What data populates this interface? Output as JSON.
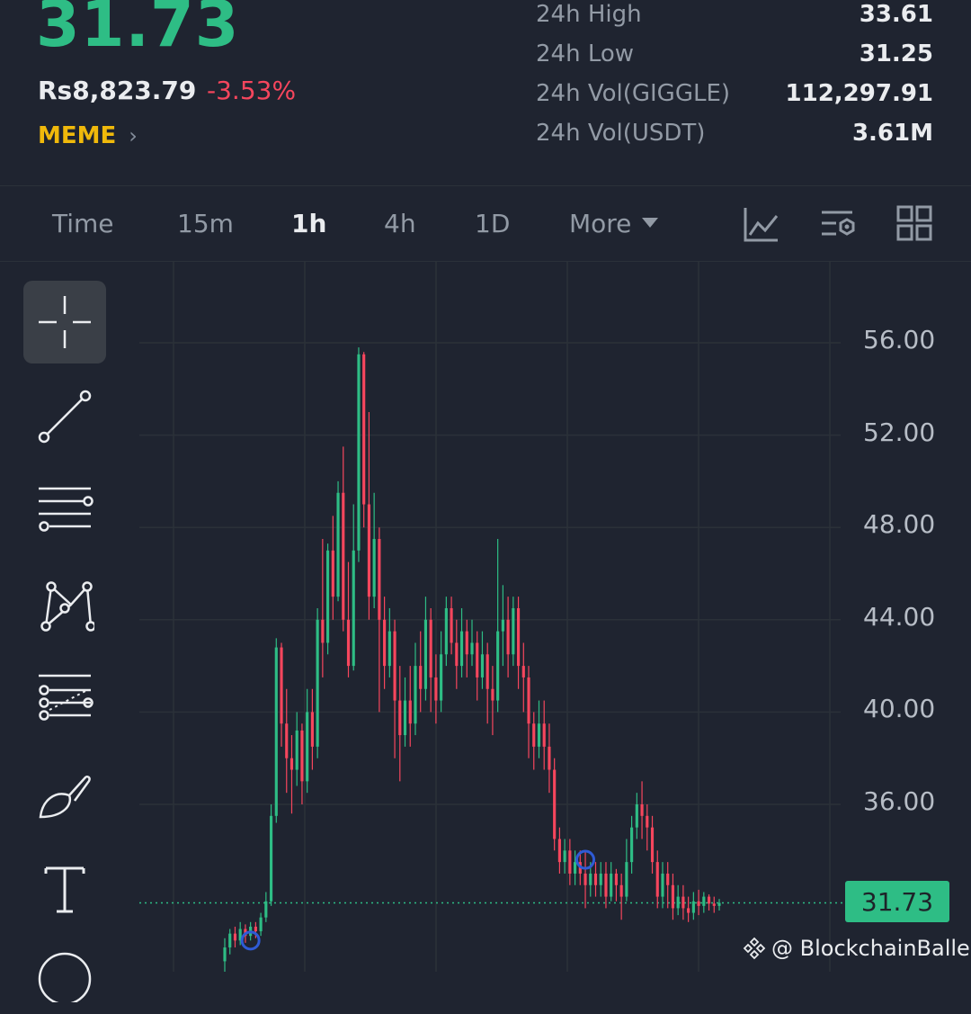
{
  "ticker": {
    "price": "31.73",
    "fiat_price": "Rs8,823.79",
    "change": "-3.53%",
    "tag": "MEME"
  },
  "stats": [
    {
      "label": "24h High",
      "value": "33.61"
    },
    {
      "label": "24h Low",
      "value": "31.25"
    },
    {
      "label": "24h Vol(GIGGLE)",
      "value": "112,297.91"
    },
    {
      "label": "24h Vol(USDT)",
      "value": "3.61M"
    }
  ],
  "tabs": [
    {
      "label": "Time",
      "active": false
    },
    {
      "label": "15m",
      "active": false
    },
    {
      "label": "1h",
      "active": true
    },
    {
      "label": "4h",
      "active": false
    },
    {
      "label": "1D",
      "active": false
    },
    {
      "label": "More",
      "active": false
    }
  ],
  "toolbar_icons": [
    "indicator-chart-icon",
    "chart-settings-icon",
    "layout-grid-icon"
  ],
  "drawing_tools": [
    "crosshair-icon",
    "trend-line-icon",
    "horizontal-lines-icon",
    "pattern-icon",
    "fib-channel-icon",
    "brush-icon",
    "text-tool-icon",
    "shape-tool-icon"
  ],
  "colors": {
    "up": "#2ebd85",
    "down": "#f6465d",
    "background": "#1f2430",
    "tag": "#f0b90b",
    "marker": "#2f5bd6"
  },
  "watermark": "@ BlockchainBaller",
  "chart_data": {
    "type": "candlestick",
    "interval": "1h",
    "y_ticks": [
      "56.00",
      "52.00",
      "48.00",
      "44.00",
      "40.00",
      "36.00"
    ],
    "ylim": [
      28.5,
      58
    ],
    "last_price": "31.73",
    "grid": true,
    "candles": [
      [
        29.2,
        29.8,
        28.6,
        30.2
      ],
      [
        29.8,
        30.4,
        29.5,
        30.6
      ],
      [
        30.4,
        30.1,
        29.8,
        30.7
      ],
      [
        30.1,
        30.6,
        29.9,
        30.9
      ],
      [
        30.6,
        30.3,
        30.0,
        30.8
      ],
      [
        30.3,
        30.7,
        30.1,
        30.9
      ],
      [
        30.7,
        30.5,
        30.2,
        30.9
      ],
      [
        30.5,
        31.1,
        30.3,
        31.3
      ],
      [
        31.1,
        31.8,
        30.9,
        32.2
      ],
      [
        31.8,
        35.5,
        31.6,
        36.0
      ],
      [
        35.5,
        42.8,
        35.2,
        43.2
      ],
      [
        42.8,
        39.5,
        38.5,
        43.0
      ],
      [
        39.5,
        38.0,
        36.5,
        41.0
      ],
      [
        38.0,
        37.5,
        35.6,
        39.0
      ],
      [
        37.5,
        39.2,
        36.8,
        40.0
      ],
      [
        39.2,
        37.0,
        36.0,
        39.5
      ],
      [
        37.0,
        40.0,
        36.5,
        41.0
      ],
      [
        40.0,
        38.5,
        37.5,
        41.0
      ],
      [
        38.5,
        44.0,
        38.0,
        44.5
      ],
      [
        44.0,
        43.0,
        41.5,
        47.5
      ],
      [
        43.0,
        47.0,
        42.5,
        47.3
      ],
      [
        47.0,
        45.0,
        44.0,
        48.5
      ],
      [
        45.0,
        49.5,
        44.8,
        50.0
      ],
      [
        49.5,
        44.0,
        43.5,
        51.5
      ],
      [
        44.0,
        42.0,
        41.5,
        46.5
      ],
      [
        42.0,
        47.0,
        41.8,
        49.0
      ],
      [
        47.0,
        55.5,
        46.5,
        55.8
      ],
      [
        55.5,
        49.0,
        48.0,
        55.6
      ],
      [
        49.0,
        45.0,
        44.0,
        53.0
      ],
      [
        45.0,
        47.5,
        44.5,
        49.5
      ],
      [
        47.5,
        44.0,
        40.0,
        48.0
      ],
      [
        44.0,
        42.0,
        41.0,
        45.0
      ],
      [
        42.0,
        43.5,
        41.5,
        44.5
      ],
      [
        43.5,
        40.5,
        38.0,
        44.0
      ],
      [
        40.5,
        39.0,
        37.0,
        42.0
      ],
      [
        39.0,
        40.5,
        38.5,
        41.5
      ],
      [
        40.5,
        39.5,
        38.5,
        42.0
      ],
      [
        39.5,
        42.0,
        39.0,
        43.0
      ],
      [
        42.0,
        41.0,
        40.0,
        43.5
      ],
      [
        41.0,
        44.0,
        40.5,
        45.0
      ],
      [
        44.0,
        41.5,
        40.0,
        44.5
      ],
      [
        41.5,
        40.5,
        39.5,
        42.5
      ],
      [
        40.5,
        42.5,
        40.0,
        43.5
      ],
      [
        42.5,
        44.5,
        42.0,
        45.0
      ],
      [
        44.5,
        43.0,
        42.5,
        45.0
      ],
      [
        43.0,
        42.0,
        41.0,
        44.0
      ],
      [
        42.0,
        43.5,
        41.5,
        44.5
      ],
      [
        43.5,
        42.5,
        41.5,
        44.0
      ],
      [
        42.5,
        43.0,
        42.0,
        44.0
      ],
      [
        43.0,
        41.5,
        40.5,
        43.5
      ],
      [
        41.5,
        42.5,
        41.0,
        43.5
      ],
      [
        42.5,
        41.0,
        39.5,
        43.0
      ],
      [
        41.0,
        40.5,
        39.0,
        42.0
      ],
      [
        40.5,
        43.5,
        40.0,
        47.5
      ],
      [
        43.5,
        44.0,
        42.0,
        45.5
      ],
      [
        44.0,
        42.5,
        41.5,
        45.0
      ],
      [
        42.5,
        44.5,
        42.0,
        45.0
      ],
      [
        44.5,
        42.0,
        41.0,
        45.0
      ],
      [
        42.0,
        41.5,
        40.0,
        43.0
      ],
      [
        41.5,
        39.5,
        38.0,
        42.0
      ],
      [
        39.5,
        38.5,
        37.5,
        40.0
      ],
      [
        38.5,
        39.5,
        38.0,
        40.5
      ],
      [
        39.5,
        38.5,
        37.5,
        40.5
      ],
      [
        38.5,
        37.5,
        36.5,
        39.5
      ],
      [
        37.5,
        34.5,
        34.0,
        38.0
      ],
      [
        34.5,
        33.5,
        33.0,
        35.0
      ],
      [
        33.5,
        34.0,
        33.0,
        34.5
      ],
      [
        34.0,
        33.0,
        32.5,
        34.5
      ],
      [
        33.0,
        33.5,
        32.5,
        34.0
      ],
      [
        33.5,
        33.0,
        32.5,
        34.0
      ],
      [
        33.0,
        32.5,
        31.5,
        34.0
      ],
      [
        32.5,
        33.0,
        32.0,
        33.5
      ],
      [
        33.0,
        32.5,
        32.0,
        33.5
      ],
      [
        32.5,
        33.0,
        32.0,
        33.5
      ],
      [
        33.0,
        32.0,
        31.5,
        33.5
      ],
      [
        32.0,
        33.0,
        31.8,
        33.5
      ],
      [
        33.0,
        32.5,
        31.8,
        33.2
      ],
      [
        32.5,
        32.0,
        31.0,
        33.0
      ],
      [
        32.0,
        33.5,
        31.8,
        34.5
      ],
      [
        33.5,
        35.0,
        33.0,
        35.5
      ],
      [
        35.0,
        36.0,
        34.5,
        36.5
      ],
      [
        36.0,
        35.5,
        34.5,
        37.0
      ],
      [
        35.5,
        35.0,
        34.0,
        36.0
      ],
      [
        35.0,
        33.5,
        33.0,
        35.5
      ],
      [
        33.5,
        32.0,
        31.5,
        34.0
      ],
      [
        32.0,
        33.0,
        31.5,
        33.5
      ],
      [
        33.0,
        32.5,
        31.5,
        33.5
      ],
      [
        32.5,
        31.5,
        31.0,
        33.0
      ],
      [
        31.5,
        32.0,
        31.2,
        32.5
      ],
      [
        32.0,
        31.5,
        31.0,
        32.5
      ],
      [
        31.5,
        31.3,
        30.9,
        32.0
      ],
      [
        31.3,
        31.8,
        31.0,
        32.2
      ],
      [
        31.8,
        31.6,
        31.2,
        32.3
      ],
      [
        31.6,
        32.0,
        31.3,
        32.2
      ],
      [
        32.0,
        31.7,
        31.4,
        32.1
      ],
      [
        31.7,
        31.6,
        31.3,
        32.0
      ],
      [
        31.6,
        31.73,
        31.4,
        31.9
      ]
    ],
    "markers": [
      {
        "candle": 5,
        "price": 30.1
      },
      {
        "candle": 70,
        "price": 33.6
      }
    ]
  }
}
